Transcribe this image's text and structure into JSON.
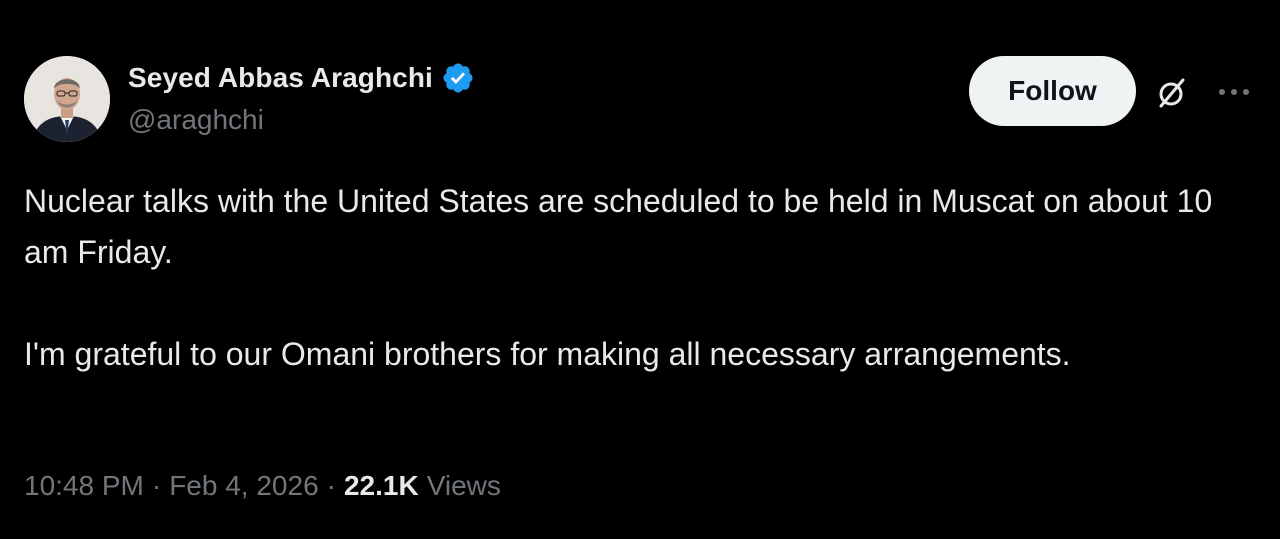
{
  "author": {
    "display_name": "Seyed Abbas Araghchi",
    "handle": "@araghchi",
    "verified_icon": "verified-badge-icon",
    "verified_color": "#1d9bf0"
  },
  "actions": {
    "follow_label": "Follow",
    "grok_icon": "grok-icon",
    "more_icon": "more-icon"
  },
  "tweet": {
    "paragraph_1": "Nuclear talks with the United States are scheduled to be held in Muscat on about 10 am Friday.",
    "paragraph_2": "I'm grateful to our Omani brothers for making all necessary arrangements."
  },
  "meta": {
    "time": "10:48 PM",
    "separator": "·",
    "date": "Feb 4, 2026",
    "views_count": "22.1K",
    "views_label": "Views"
  },
  "colors": {
    "background": "#000000",
    "text_primary": "#e7e9ea",
    "text_secondary": "#71767b",
    "follow_bg": "#eff3f4"
  }
}
